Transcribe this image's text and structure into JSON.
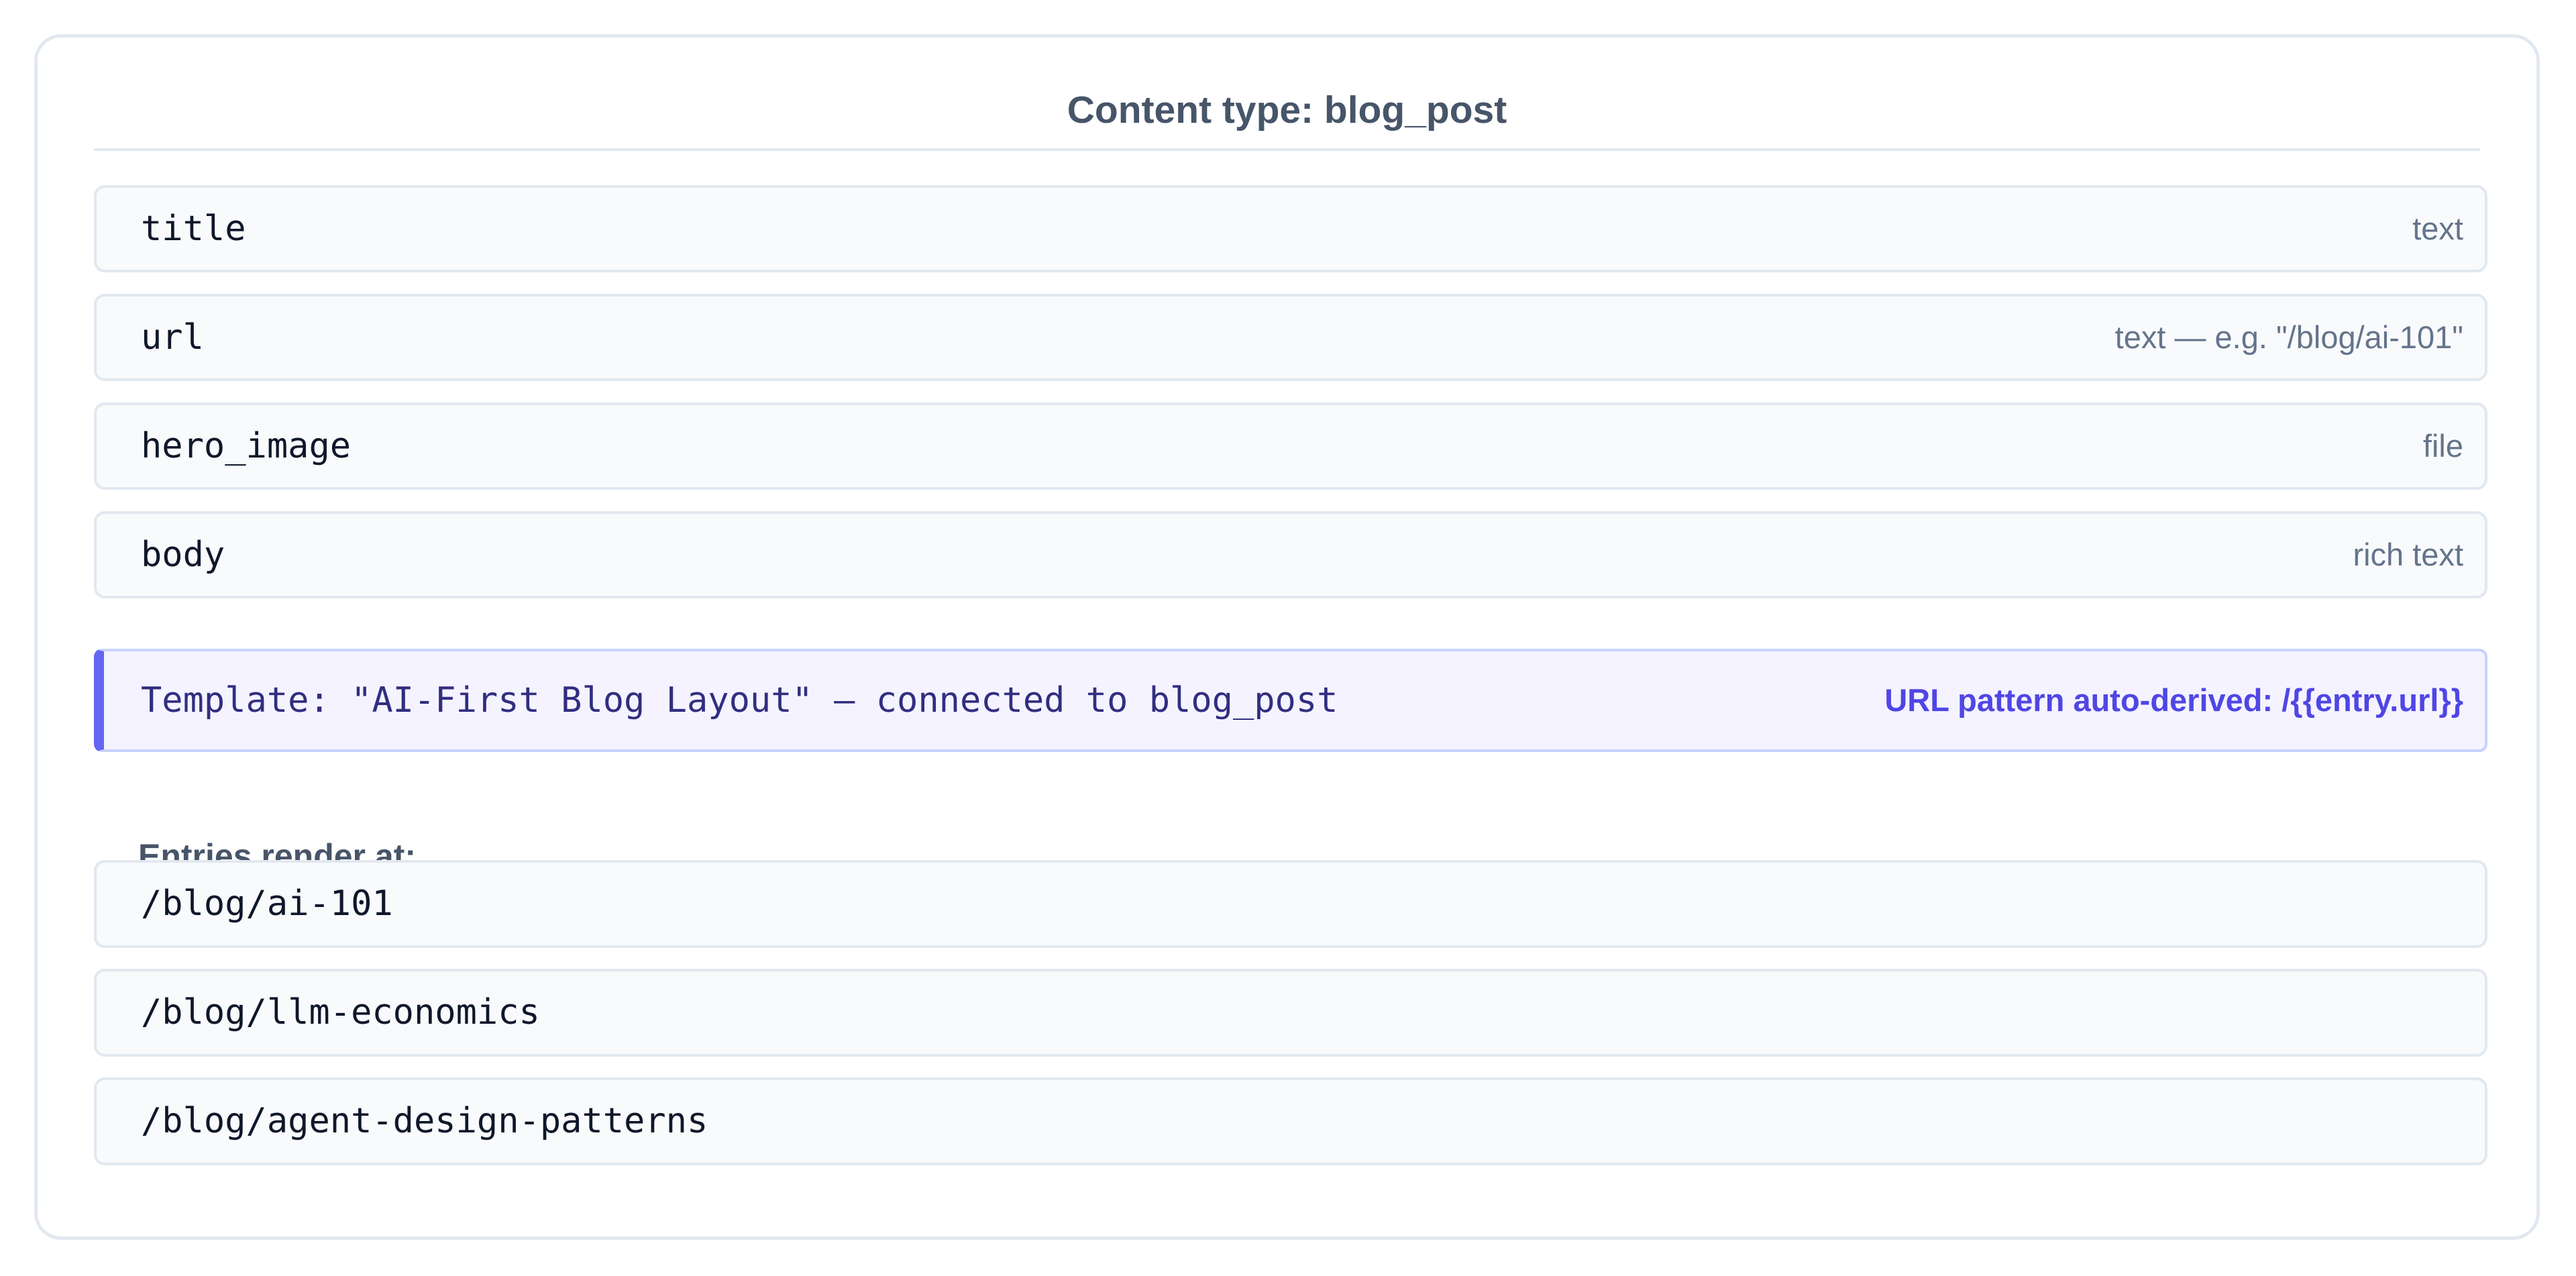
{
  "content_type": {
    "title": "Content type: blog_post"
  },
  "fields": [
    {
      "name": "title",
      "type": "text"
    },
    {
      "name": "url",
      "type": "text — e.g. \"/blog/ai-101\""
    },
    {
      "name": "hero_image",
      "type": "file"
    },
    {
      "name": "body",
      "type": "rich text"
    }
  ],
  "template": {
    "label": "Template: \"AI-First Blog Layout\" — connected to blog_post",
    "url_pattern": "URL pattern auto-derived: /{{entry.url}}"
  },
  "entries": {
    "heading": "Entries render at:",
    "paths": [
      "/blog/ai-101",
      "/blog/llm-economics",
      "/blog/agent-design-patterns"
    ]
  },
  "colors": {
    "accent": "#6366f1",
    "accent_text": "#4f46e5",
    "border": "#e2e8f0",
    "row_background": "#f8fafc"
  }
}
